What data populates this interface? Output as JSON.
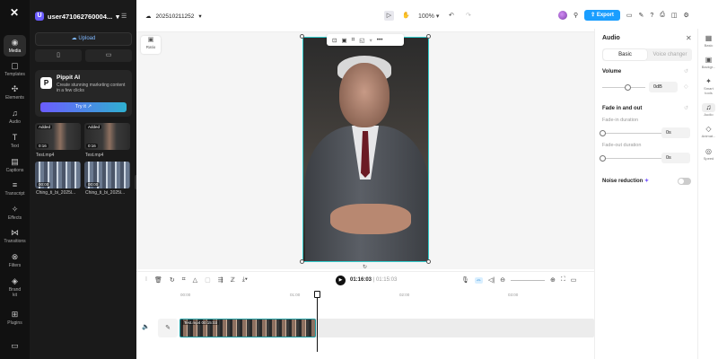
{
  "app": {
    "logo": "✕"
  },
  "rail": {
    "items": [
      {
        "label": "Media",
        "icon": "media-icon",
        "glyph": "◉"
      },
      {
        "label": "Templates",
        "icon": "templates-icon",
        "glyph": "▢"
      },
      {
        "label": "Elements",
        "icon": "elements-icon",
        "glyph": "✣"
      },
      {
        "label": "Audio",
        "icon": "audio-icon",
        "glyph": "♫"
      },
      {
        "label": "Text",
        "icon": "text-icon",
        "glyph": "T"
      },
      {
        "label": "Captions",
        "icon": "captions-icon",
        "glyph": "▤"
      },
      {
        "label": "Transcript",
        "icon": "transcript-icon",
        "glyph": "≡"
      },
      {
        "label": "Effects",
        "icon": "effects-icon",
        "glyph": "✧"
      },
      {
        "label": "Transitions",
        "icon": "transitions-icon",
        "glyph": "⋈"
      },
      {
        "label": "Filters",
        "icon": "filters-icon",
        "glyph": "⊗"
      },
      {
        "label": "Brand kit",
        "icon": "brand-kit-icon",
        "glyph": "◈"
      },
      {
        "label": "Plugins",
        "icon": "plugins-icon",
        "glyph": "⊞"
      },
      {
        "label": "",
        "icon": "keyboard-icon",
        "glyph": "▭"
      }
    ]
  },
  "media": {
    "username": "user471062760004...",
    "upload_label": "Upload",
    "promo": {
      "title": "Pippit AI",
      "description": "Create stunning marketing content in a few clicks",
      "button": "Try it ↗"
    },
    "items": [
      {
        "name": "Test.mp4",
        "badge": "Added",
        "duration": "0:16"
      },
      {
        "name": "Test.mp4",
        "badge": "Added",
        "duration": "0:16"
      },
      {
        "name": "Ching_ti_bi_2025l...",
        "badge": "",
        "duration": "00:00"
      },
      {
        "name": "Ching_ti_bi_2025l...",
        "badge": "",
        "duration": "00:00"
      }
    ]
  },
  "topbar": {
    "project_name": "202510211252",
    "zoom": "100%",
    "export_label": "Export"
  },
  "canvas": {
    "ratio_label": "Ratio"
  },
  "timeline": {
    "current_time": "01:16:03",
    "total_time": "01:15:03",
    "ruler": [
      "00:00",
      "01:00",
      "02:00",
      "03:00"
    ],
    "clip_name": "Test.mp4  00:15:03"
  },
  "audio_panel": {
    "title": "Audio",
    "tabs": [
      "Basic",
      "Voice changer"
    ],
    "volume_label": "Volume",
    "volume_value": "0dB",
    "fade_label": "Fade in and out",
    "fade_in_label": "Fade-in duration",
    "fade_in_value": "0s",
    "fade_out_label": "Fade-out duration",
    "fade_out_value": "0s",
    "noise_label": "Noise reduction",
    "volume_level": 0.6,
    "noise_reduction": false
  },
  "right_rail": {
    "items": [
      {
        "label": "Basic",
        "icon": "basic-icon",
        "glyph": "▦"
      },
      {
        "label": "Backgr...",
        "icon": "background-icon",
        "glyph": "▣"
      },
      {
        "label": "Smart tools",
        "icon": "smart-tools-icon",
        "glyph": "✦"
      },
      {
        "label": "Audio",
        "icon": "audio-icon",
        "glyph": "♫"
      },
      {
        "label": "Animat...",
        "icon": "animation-icon",
        "glyph": "◇"
      },
      {
        "label": "Speed",
        "icon": "speed-icon",
        "glyph": "◎"
      }
    ]
  },
  "colors": {
    "accent": "#1a9eff",
    "clip_border": "#1a9aa0",
    "rail_bg": "#111111"
  }
}
